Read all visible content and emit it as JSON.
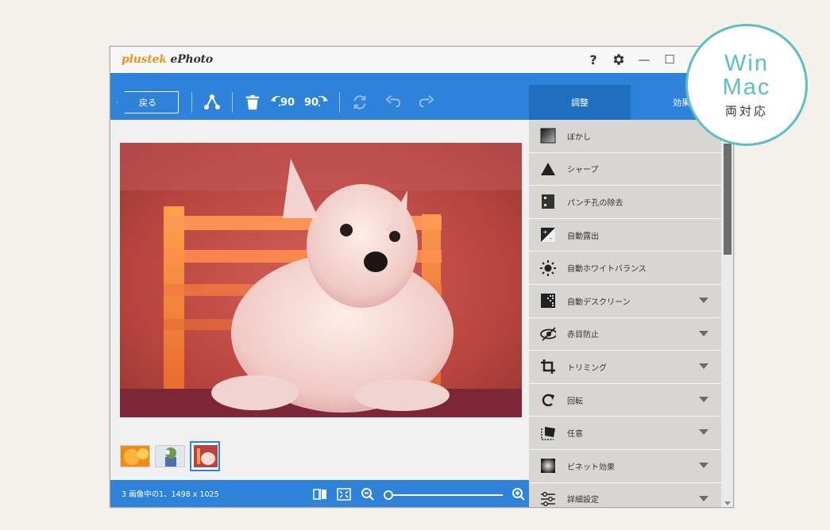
{
  "app": {
    "brand": "plustek",
    "product": " ePhoto"
  },
  "titlebar": {
    "help": "?",
    "minimize": "—",
    "maximize": "☐"
  },
  "toolbar": {
    "back_label": "戻る",
    "rotate_left_label": "90",
    "rotate_right_label": "90"
  },
  "tabs": [
    {
      "label": "調整"
    },
    {
      "label": "効果"
    }
  ],
  "panel": {
    "items": [
      {
        "label": "ぼかし",
        "icon": "blur-icon",
        "expandable": false
      },
      {
        "label": "シャープ",
        "icon": "sharpen-icon",
        "expandable": false
      },
      {
        "label": "パンチ孔の除去",
        "icon": "punch-hole-icon",
        "expandable": false
      },
      {
        "label": "自動露出",
        "icon": "exposure-icon",
        "expandable": false
      },
      {
        "label": "自動ホワイトバランス",
        "icon": "white-balance-icon",
        "expandable": false
      },
      {
        "label": "自動デスクリーン",
        "icon": "descreen-icon",
        "expandable": true
      },
      {
        "label": "赤目防止",
        "icon": "red-eye-icon",
        "expandable": true
      },
      {
        "label": "トリミング",
        "icon": "crop-icon",
        "expandable": true
      },
      {
        "label": "回転",
        "icon": "rotate-icon",
        "expandable": true
      },
      {
        "label": "任意",
        "icon": "custom-icon",
        "expandable": true
      },
      {
        "label": "ビネット効果",
        "icon": "vignette-icon",
        "expandable": true
      },
      {
        "label": "詳細設定",
        "icon": "settings-sliders-icon",
        "expandable": true
      }
    ]
  },
  "status": {
    "text": "3 画像中の1、1498 x 1025",
    "zoom_level": 0
  },
  "badge": {
    "line1": "Win",
    "line2": "Mac",
    "line3": "両対応"
  },
  "colors": {
    "accent": "#2e82d9",
    "badge": "#5dbfbf",
    "logo_orange": "#e8951a"
  }
}
